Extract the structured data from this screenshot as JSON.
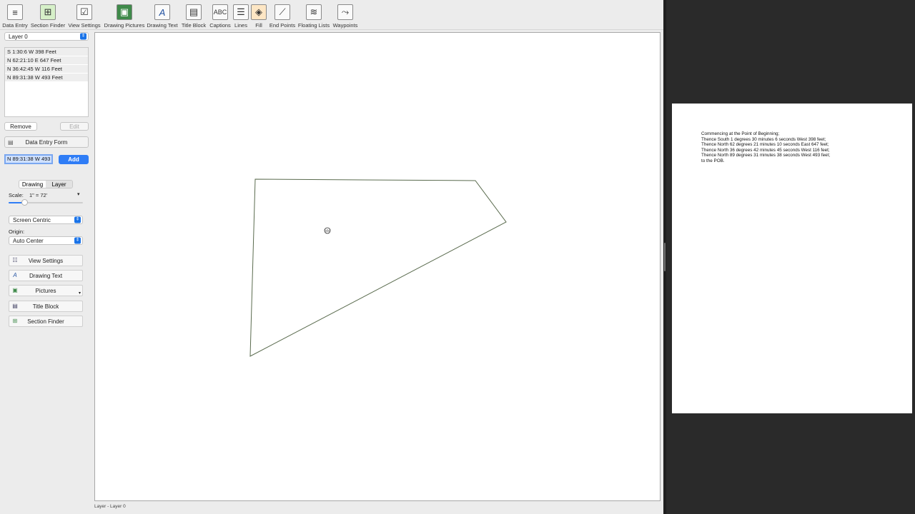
{
  "toolbar": {
    "items": [
      {
        "label": "Data Entry",
        "icon": "data-entry-icon"
      },
      {
        "label": "Section Finder",
        "icon": "section-finder-icon"
      },
      {
        "label": "View Settings",
        "icon": "view-settings-icon"
      },
      {
        "label": "Drawing Pictures",
        "icon": "drawing-pictures-icon"
      },
      {
        "label": "Drawing Text",
        "icon": "drawing-text-icon"
      },
      {
        "label": "Title Block",
        "icon": "title-block-icon"
      },
      {
        "label": "Captions",
        "icon": "captions-icon"
      },
      {
        "label": "Lines",
        "icon": "lines-icon"
      },
      {
        "label": "Fill",
        "icon": "fill-icon"
      },
      {
        "label": "End Points",
        "icon": "end-points-icon"
      },
      {
        "label": "Floating Lists",
        "icon": "floating-lists-icon"
      },
      {
        "label": "Waypoints",
        "icon": "waypoints-icon"
      }
    ]
  },
  "sidebar": {
    "layer_select": "Layer 0",
    "calls": [
      "S 1:30:6 W 398 Feet",
      "N 62:21:10 E 647 Feet",
      "N 36:42:45 W 116 Feet",
      "N 89:31:38 W 493 Feet"
    ],
    "remove_label": "Remove",
    "edit_label": "Edit",
    "data_entry_form_label": "Data Entry Form",
    "entry_value": "N 89:31:38 W 493",
    "add_label": "Add",
    "tabs": {
      "drawing": "Drawing",
      "layer": "Layer"
    },
    "scale_label": "Scale:",
    "scale_value": "1\" = 72'",
    "scale_slider_fraction": 0.22,
    "centric_select": "Screen Centric",
    "origin_label": "Origin:",
    "origin_select": "Auto Center",
    "buttons": {
      "view_settings": "View Settings",
      "drawing_text": "Drawing Text",
      "pictures": "Pictures",
      "title_block": "Title Block",
      "section_finder": "Section Finder"
    }
  },
  "status_bar": "Layer - Layer 0",
  "legal_description": [
    "Commencing at the Point of Beginning;",
    "Thence South 1 degrees 30 minutes 6 seconds West 398 feet;",
    "Thence North 62 degrees 21 minutes 10 seconds East 647 feet;",
    "Thence North 36 degrees 42 minutes 45 seconds West 116 feet;",
    "Thence North 89 degrees 31 minutes 38 seconds West 493 feet;",
    "to the POB."
  ],
  "colors": {
    "accent": "#2f7df6",
    "plot_line": "#5a6b4e"
  }
}
